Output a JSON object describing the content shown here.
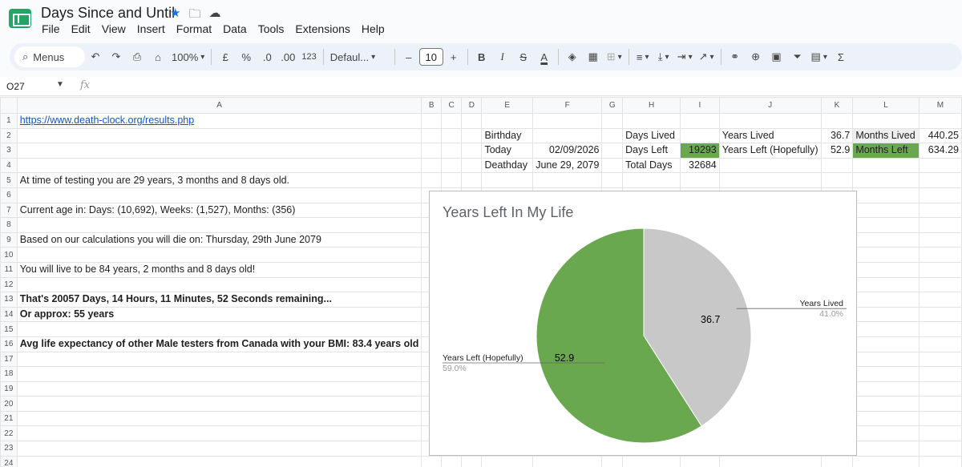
{
  "app": {
    "title": "Days Since and Until",
    "menu": [
      "File",
      "Edit",
      "View",
      "Insert",
      "Format",
      "Data",
      "Tools",
      "Extensions",
      "Help"
    ]
  },
  "toolbar": {
    "menus_label": "Menus",
    "zoom": "100%",
    "currency": "£",
    "percent": "%",
    "dec_decrease": ".0",
    "dec_increase": ".00",
    "format_more": "123",
    "font": "Defaul...",
    "font_size": "10",
    "minus": "–",
    "plus": "+",
    "bold": "B",
    "italic": "I",
    "strike": "S",
    "textcolor": "A",
    "sum": "Σ"
  },
  "formula_bar": {
    "cell_ref": "O27",
    "fx": "fx",
    "value": ""
  },
  "columns": [
    "A",
    "B",
    "C",
    "D",
    "E",
    "F",
    "G",
    "H",
    "I",
    "J",
    "K",
    "L",
    "M"
  ],
  "cells": {
    "A1": "https://www.death-clock.org/results.php",
    "E2": "Birthday",
    "E3": "Today",
    "F3": "02/09/2026",
    "E4": "Deathday",
    "F4": "June 29, 2079",
    "H2": "Days Lived",
    "H3": "Days Left",
    "I3": "19293",
    "H4": "Total Days",
    "I4": "32684",
    "J2": "Years Lived",
    "K2": "36.7",
    "L2": "Months Lived",
    "M2": "440.25",
    "J3": "Years Left (Hopefully)",
    "K3": "52.9",
    "L3": "Months Left",
    "M3": "634.29",
    "A5": "At time of testing you are 29 years, 3 months and 8 days old.",
    "A7": "Current age in: Days: (10,692), Weeks: (1,527), Months: (356)",
    "A9": "Based on our calculations you will die on: Thursday, 29th June 2079",
    "A11": "You will live to be 84 years, 2 months and 8 days old!",
    "A13": "That's 20057 Days, 14 Hours, 11 Minutes, 52 Seconds remaining...",
    "A14": "Or approx: 55 years",
    "A16": "Avg life expectancy of other Male testers from Canada with your BMI:  83.4 years old"
  },
  "chart_data": {
    "type": "pie",
    "title": "Years Left In My Life",
    "slices": [
      {
        "label": "Years Lived",
        "value": 36.7,
        "percent": "41.0%",
        "color": "#c8c8c8"
      },
      {
        "label": "Years Left (Hopefully)",
        "value": 52.9,
        "percent": "59.0%",
        "color": "#6aa84f"
      }
    ],
    "value_labels": [
      "36.7",
      "52.9"
    ],
    "legend": "none"
  }
}
